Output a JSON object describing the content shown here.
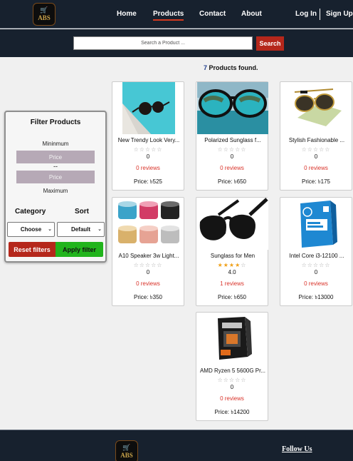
{
  "brand": {
    "logo_text": "ABS",
    "logo_icon": "cart-icon"
  },
  "nav": {
    "home": "Home",
    "products": "Products",
    "contact": "Contact",
    "about": "About",
    "login": "Log In",
    "signup": "Sign Up",
    "active": "Products",
    "accent_color": "#d43a1f"
  },
  "search": {
    "placeholder": "Search a Product ...",
    "value": "",
    "button": "Search",
    "button_color": "#b5271b"
  },
  "results": {
    "count": "7",
    "label": " Products found."
  },
  "filter": {
    "title": "Filter Products",
    "minimum": "Mininmum",
    "price_placeholder": "Price",
    "dash": "--",
    "maximum": "Maximum",
    "category_label": "Category",
    "sort_label": "Sort",
    "category_value": "Choose",
    "sort_value": "Default",
    "reset": "Reset filters",
    "apply": "Apply filter",
    "reset_color": "#b5271b",
    "apply_color": "#21b41c"
  },
  "products": [
    {
      "name": "New Trendy Look Very...",
      "rating": "0",
      "stars_on": 0,
      "reviews": "0 reviews",
      "price": "Price: ৳525",
      "image": "sunglasses-on-pool"
    },
    {
      "name": "Polarized Sunglass f...",
      "rating": "0",
      "stars_on": 0,
      "reviews": "0 reviews",
      "price": "Price: ৳650",
      "image": "sunglasses-lake-view"
    },
    {
      "name": "Stylish Fashionable ...",
      "rating": "0",
      "stars_on": 0,
      "reviews": "0 reviews",
      "price": "Price: ৳175",
      "image": "aviator-sunglasses"
    },
    {
      "name": "A10 Speaker 3w Light...",
      "rating": "0",
      "stars_on": 0,
      "reviews": "0 reviews",
      "price": "Price: ৳350",
      "image": "mini-speakers"
    },
    {
      "name": "Sunglass for Men",
      "rating": "4.0",
      "stars_on": 4,
      "reviews": "1 reviews",
      "price": "Price: ৳650",
      "image": "black-sunglasses"
    },
    {
      "name": "Intel Core i3-12100 ...",
      "rating": "0",
      "stars_on": 0,
      "reviews": "0 reviews",
      "price": "Price: ৳13000",
      "image": "intel-core-box"
    },
    {
      "name": "AMD Ryzen 5 5600G Pr...",
      "rating": "0",
      "stars_on": 0,
      "reviews": "0 reviews",
      "price": "Price: ৳14200",
      "image": "amd-ryzen-box"
    }
  ],
  "footer": {
    "follow": "Follow Us"
  }
}
